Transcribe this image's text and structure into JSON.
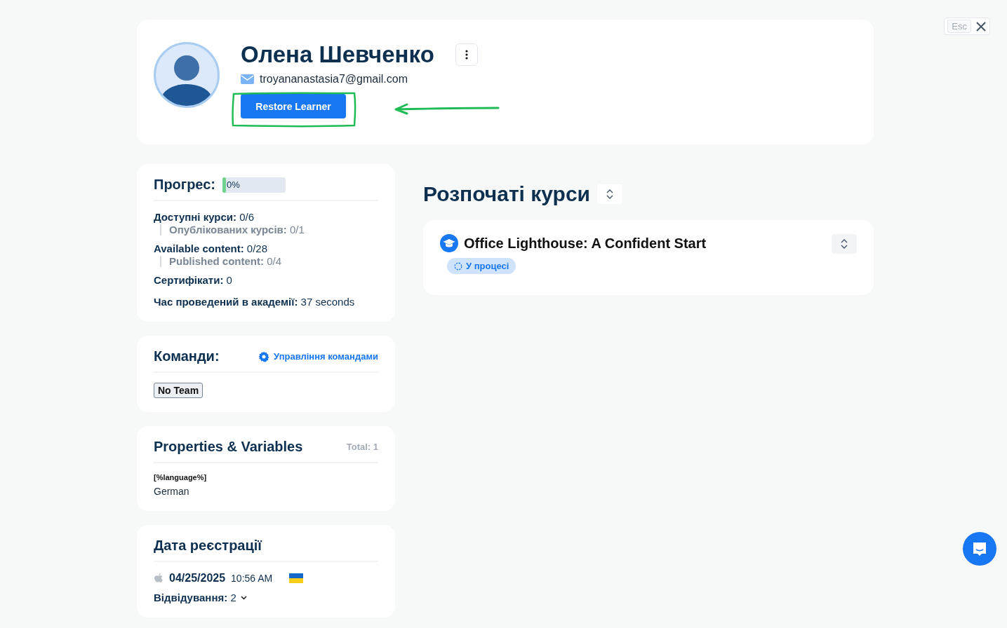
{
  "profile": {
    "name": "Олена Шевченко",
    "email": "troyananastasia7@gmail.com",
    "restore_button": "Restore Learner"
  },
  "progress": {
    "title": "Прогрес:",
    "level": 0,
    "reading": "0%"
  },
  "stats": [
    {
      "kind": "main",
      "label": "Доступні курси:",
      "value": "0/6"
    },
    {
      "kind": "sub",
      "label": "Опублікованих курсів:",
      "value": "0/1"
    },
    {
      "kind": "main",
      "label": "Available content:",
      "value": "0/28"
    },
    {
      "kind": "sub",
      "label": "Published content:",
      "value": "0/4"
    },
    {
      "kind": "main",
      "label": "Сертифікати:",
      "value": "0"
    },
    {
      "kind": "main",
      "label": "Час проведений в академії:",
      "value": "37 seconds"
    }
  ],
  "teams": {
    "title": "Команди:",
    "manage_link": "Управління командами",
    "items": [
      "No Team"
    ]
  },
  "properties": {
    "title": "Properties & Variables",
    "total": "Total: 1",
    "items": [
      {
        "key": "[%language%]",
        "value": "German"
      }
    ]
  },
  "registration": {
    "title": "Дата реєстрації",
    "date": "04/25/2025",
    "time": "10:56 AM",
    "visits_label": "Відвідування:",
    "visits": "2"
  },
  "courses": {
    "title": "Розпочаті курси",
    "items": [
      {
        "title": "Office Lighthouse: A Confident Start",
        "status": "У процесі"
      }
    ]
  },
  "esc_key": "Esc"
}
